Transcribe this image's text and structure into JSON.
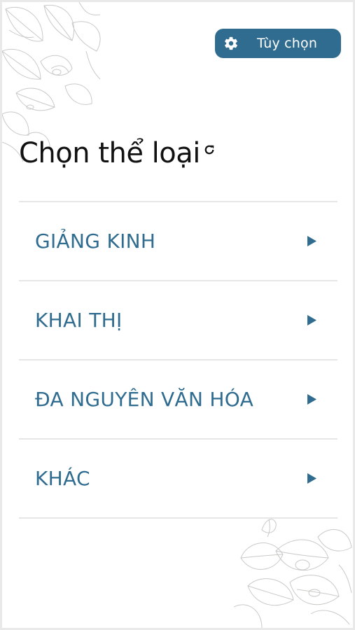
{
  "header": {
    "options_label": "Tùy chọn",
    "options_icon": "gear-icon"
  },
  "page": {
    "title": "Chọn thể loại",
    "refresh_icon": "refresh-icon"
  },
  "categories": [
    {
      "label": "GIẢNG KINH",
      "icon": "triangle-right-icon"
    },
    {
      "label": "KHAI THỊ",
      "icon": "triangle-right-icon"
    },
    {
      "label": "ĐA NGUYÊN VĂN HÓA",
      "icon": "triangle-right-icon"
    },
    {
      "label": "KHÁC",
      "icon": "triangle-right-icon"
    }
  ],
  "colors": {
    "accent": "#2f6c8f",
    "title_text": "#111111",
    "divider": "#e6e6e6",
    "floral_line": "#c9c9c6"
  }
}
